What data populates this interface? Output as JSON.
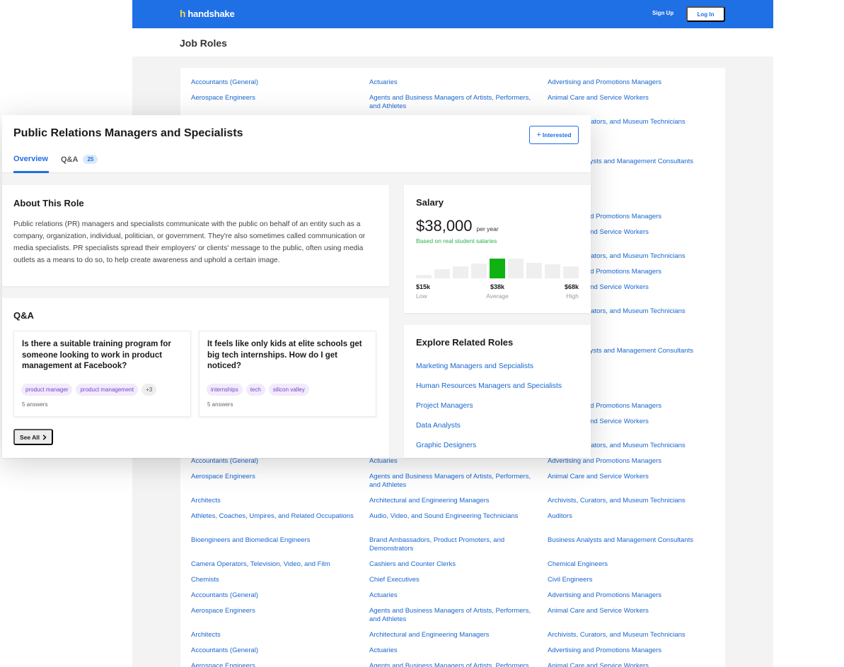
{
  "brand": {
    "logo_mark": "h",
    "name": "handshake"
  },
  "nav": {
    "signup": "Sign Up",
    "login": "Log In"
  },
  "page": {
    "heading": "Job Roles"
  },
  "colors": {
    "brand_blue": "#1f6fe5",
    "salary_green": "#10b213",
    "link_blue": "#1a67cf"
  },
  "role_columns": [
    [
      "Accountants (General)",
      "Aerospace Engineers",
      "Architects",
      "Athletes, Coaches, Umpires, and Related Occupations",
      "Bioengineers and Biomedical Engineers",
      "Camera Operators, Television, Video, and Film",
      "Chemists"
    ],
    [
      "Actuaries",
      "Agents and Business Managers of Artists, Performers, and Athletes",
      "Architectural and Engineering Managers",
      "Audio, Video, and Sound Engineering Technicians",
      "Brand Ambassadors, Product Promoters, and Demonstrators",
      "Cashiers and Counter Clerks",
      "Chief Executives"
    ],
    [
      "Advertising and Promotions Managers",
      "Animal Care and Service Workers",
      "Archivists, Curators, and Museum Technicians",
      "Auditors",
      "Business Analysts and Management Consultants",
      "Chemical Engineers",
      "Civil Engineers"
    ]
  ],
  "modal": {
    "title": "Public Relations Managers and Specialists",
    "interested_icon": "+",
    "interested_label": "Interested",
    "tabs": {
      "overview": "Overview",
      "qa": "Q&A",
      "qa_count": "25"
    },
    "about": {
      "title": "About This Role",
      "text": "Public relations (PR) managers and specialists communicate with the public on behalf of an entity such as a company, organization, individual, politician, or government. They're also sometimes called communication or media specialists. PR specialists spread their employers' or clients' message to the public, often using media outlets as a means to do so, to help create awareness and uphold a certain image."
    },
    "qa": {
      "title": "Q&A",
      "questions": [
        {
          "text": "Is there a suitable training program for someone looking to work in product management at Facebook?",
          "tags": [
            "product manager",
            "product management",
            "+3"
          ],
          "answers": "5 answers"
        },
        {
          "text": "It feels like only kids at elite schools get big tech internships. How do I get noticed?",
          "tags": [
            "internships",
            "tech",
            "silicon valley"
          ],
          "answers": "5 answers"
        }
      ],
      "see_all": "See All",
      "see_all_icon": "chevron-right-icon"
    },
    "salary": {
      "title": "Salary",
      "amount": "$38,000",
      "period": "per year",
      "note": "Based on real student salaries",
      "distribution": [
        0.15,
        0.38,
        0.5,
        0.65,
        0.85,
        0.85,
        0.68,
        0.6,
        0.5
      ],
      "highlight_index": 4,
      "low_value": "$15k",
      "low_label": "Low",
      "avg_value": "$38k",
      "avg_label": "Average",
      "high_value": "$68k",
      "high_label": "High"
    },
    "related": {
      "title": "Explore Related Roles",
      "roles": [
        "Marketing Managers and Sepcialists",
        "Human Resources Managers and Specialists",
        "Project Managers",
        "Data Analysts",
        "Graphic Designers"
      ]
    }
  }
}
